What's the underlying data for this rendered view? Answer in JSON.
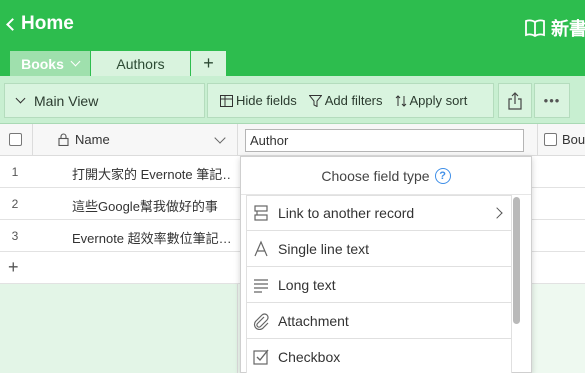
{
  "topbar": {
    "back_label": "Home",
    "right_label": "新書"
  },
  "tabs": [
    {
      "label": "Books"
    },
    {
      "label": "Authors"
    },
    {
      "label": "+"
    }
  ],
  "toolbar": {
    "view_label": "Main View",
    "hide_fields": "Hide fields",
    "add_filters": "Add filters",
    "apply_sort": "Apply sort",
    "more": "•••"
  },
  "grid": {
    "name_header": "Name",
    "author_header_value": "Author",
    "bou_header": "Bou",
    "rows": [
      {
        "num": "1",
        "name": "打開大家的 Evernote 筆記…"
      },
      {
        "num": "2",
        "name": "這些Google幫我做好的事"
      },
      {
        "num": "3",
        "name": "Evernote 超效率數位筆記…"
      }
    ],
    "add_row": "+"
  },
  "popup": {
    "title": "Choose field type",
    "help": "?",
    "options": [
      {
        "label": "Link to another record",
        "icon": "link-record-icon"
      },
      {
        "label": "Single line text",
        "icon": "text-a-icon"
      },
      {
        "label": "Long text",
        "icon": "long-text-icon"
      },
      {
        "label": "Attachment",
        "icon": "paperclip-icon"
      },
      {
        "label": "Checkbox",
        "icon": "checkbox-icon"
      }
    ]
  },
  "colors": {
    "brand_green": "#2dbd4e",
    "light_green": "#c8efd1",
    "help_blue": "#3f8fe8"
  }
}
